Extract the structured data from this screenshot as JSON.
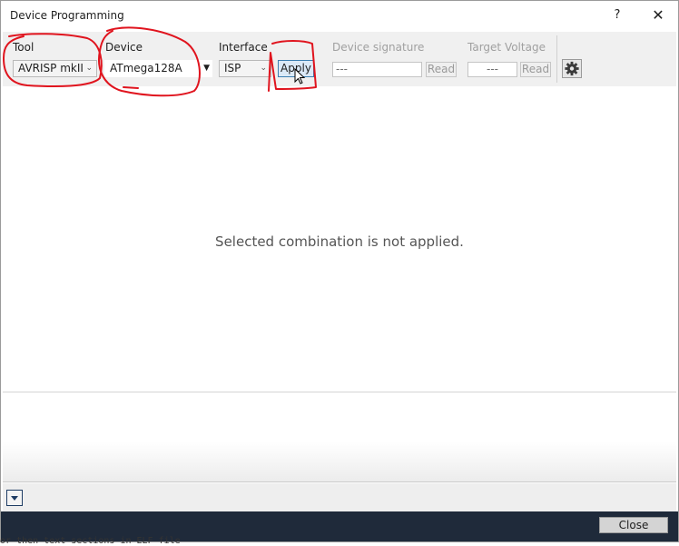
{
  "window": {
    "title": "Device Programming",
    "help_glyph": "?",
    "close_glyph": "✕"
  },
  "toolbar": {
    "tool": {
      "label": "Tool",
      "value": "AVRISP mkII"
    },
    "device": {
      "label": "Device",
      "value": "ATmega128A"
    },
    "interface": {
      "label": "Interface",
      "value": "ISP"
    },
    "apply_label": "Apply",
    "device_signature": {
      "label": "Device signature",
      "value": "---",
      "read_label": "Read"
    },
    "target_voltage": {
      "label": "Target Voltage",
      "value": "---",
      "read_label": "Read"
    }
  },
  "main": {
    "message": "Selected combination is not applied."
  },
  "footer": {
    "close_label": "Close"
  },
  "background_text": "or then  text sections in ELF file",
  "colors": {
    "annotation": "#e0141e",
    "footer_bg": "#1f2a3a",
    "apply_border": "#3c7fb1"
  }
}
